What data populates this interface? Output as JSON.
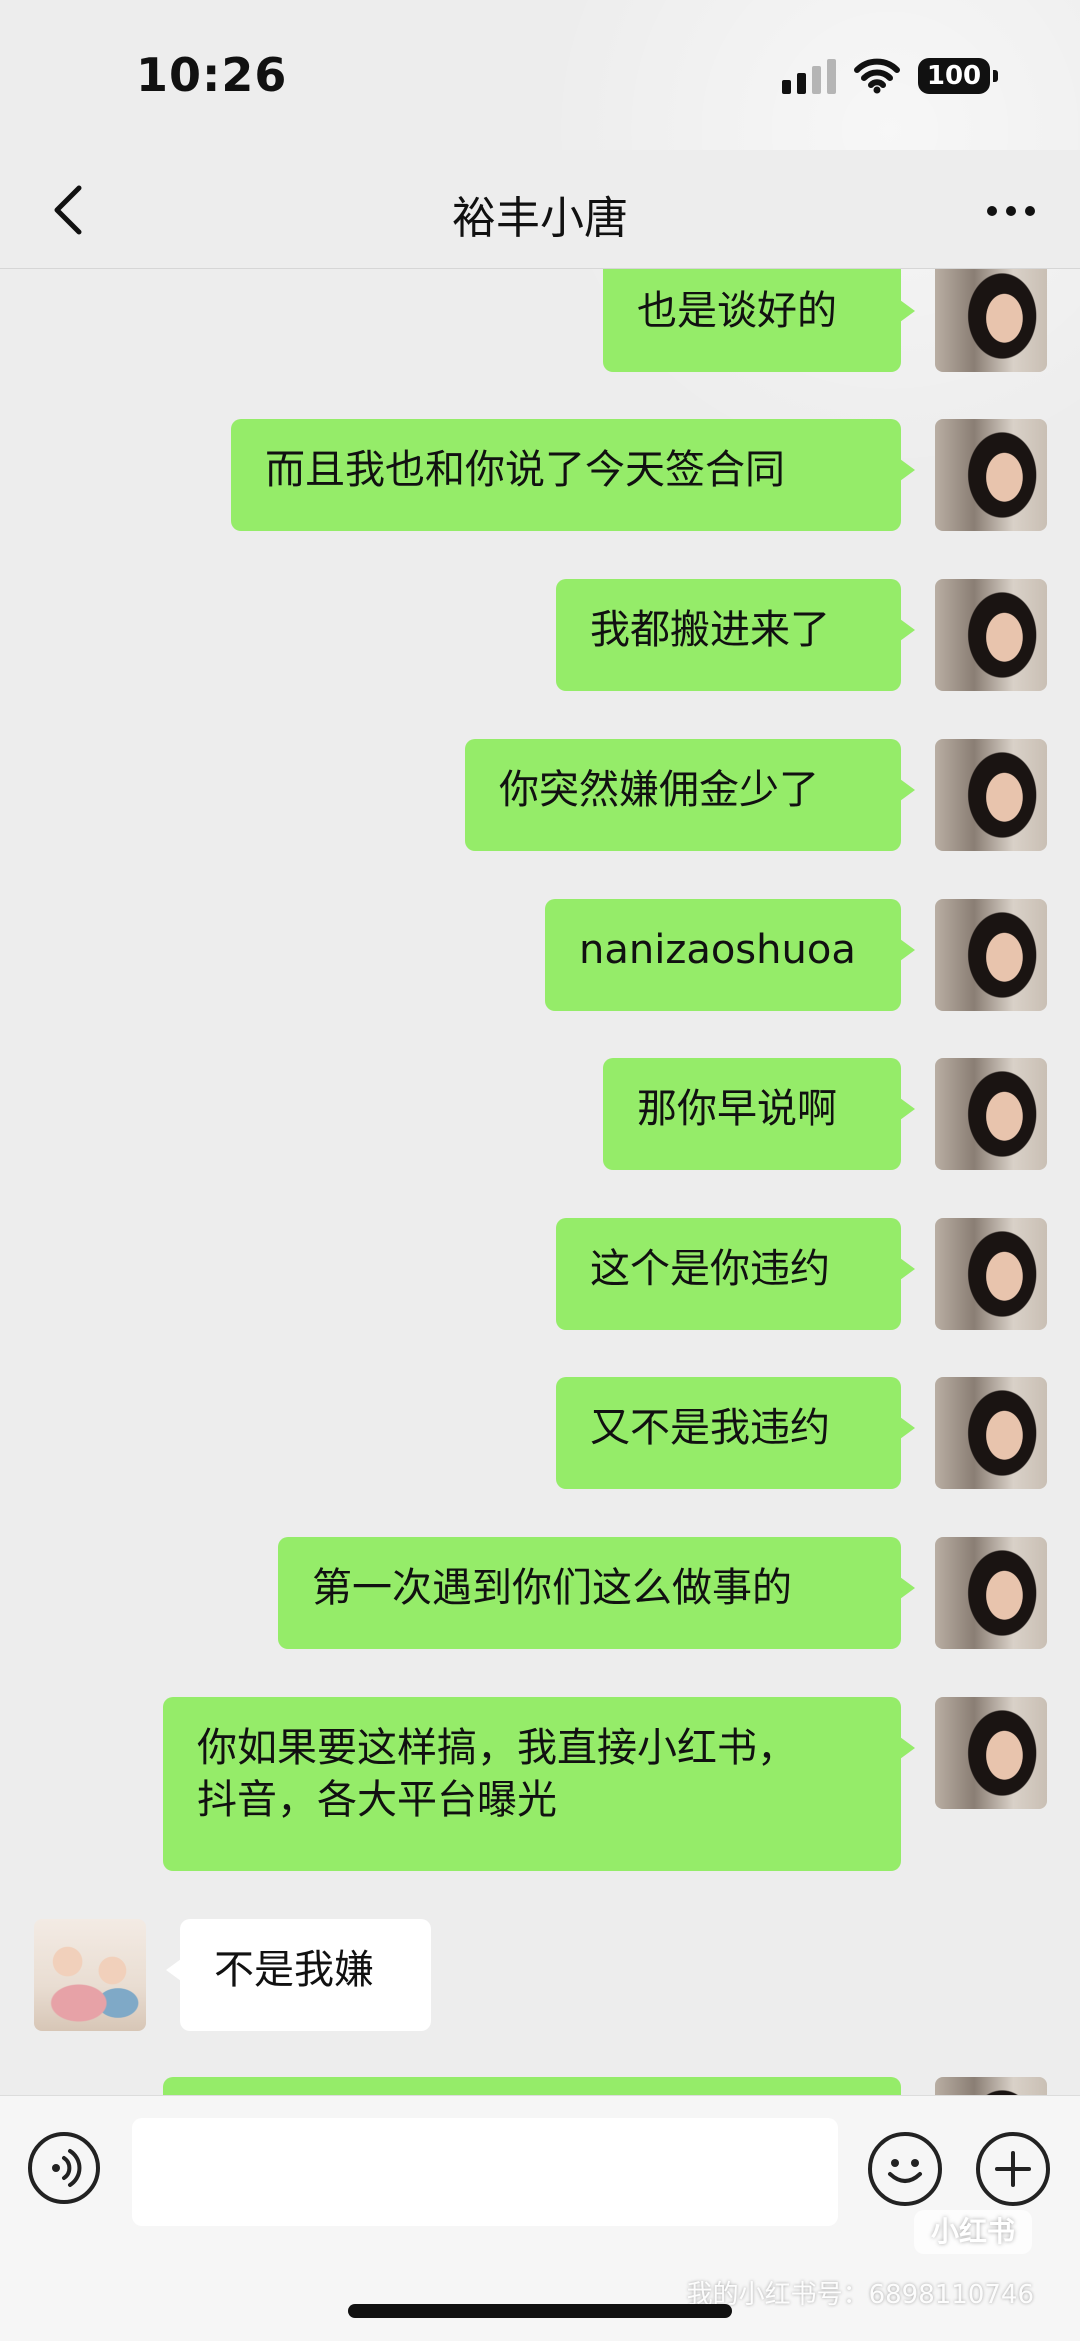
{
  "status_bar": {
    "time": "10:26",
    "battery": "100",
    "signal_icon": "cellular-signal-icon",
    "wifi_icon": "wifi-icon"
  },
  "header": {
    "title": "裕丰小唐",
    "back_icon": "chevron-left-icon",
    "more_icon": "more-dots-icon"
  },
  "messages": [
    {
      "sender": "me",
      "text": "也是谈好的"
    },
    {
      "sender": "me",
      "text": "而且我也和你说了今天签合同"
    },
    {
      "sender": "me",
      "text": "我都搬进来了"
    },
    {
      "sender": "me",
      "text": "你突然嫌佣金少了"
    },
    {
      "sender": "me",
      "text": "nanizaoshuoa"
    },
    {
      "sender": "me",
      "text": "那你早说啊"
    },
    {
      "sender": "me",
      "text": "这个是你违约"
    },
    {
      "sender": "me",
      "text": "又不是我违约"
    },
    {
      "sender": "me",
      "text": "第一次遇到你们这么做事的"
    },
    {
      "sender": "me",
      "text": "你如果要这样搞，我直接小红书，\n抖音，各大平台曝光"
    },
    {
      "sender": "other",
      "text": "不是我嫌"
    },
    {
      "sender": "me",
      "text": ""
    }
  ],
  "input_bar": {
    "placeholder": "",
    "voice_icon": "voice-icon",
    "emoji_icon": "emoji-icon",
    "plus_icon": "plus-icon"
  },
  "watermark": {
    "logo": "小红书",
    "id_text": "我的小红书号：6898110746"
  }
}
